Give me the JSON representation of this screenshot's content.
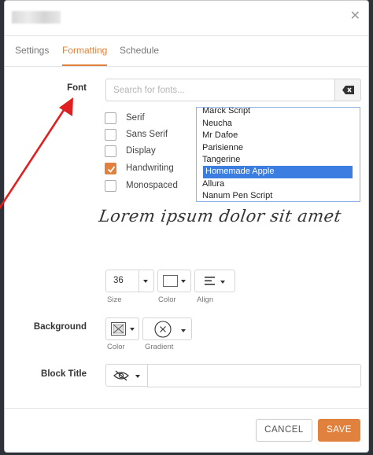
{
  "tabs": [
    {
      "label": "Settings"
    },
    {
      "label": "Formatting"
    },
    {
      "label": "Schedule"
    }
  ],
  "active_tab": "Formatting",
  "font": {
    "label": "Font",
    "search_placeholder": "Search for fonts...",
    "categories": [
      {
        "label": "Serif",
        "checked": false
      },
      {
        "label": "Sans Serif",
        "checked": false
      },
      {
        "label": "Display",
        "checked": false
      },
      {
        "label": "Handwriting",
        "checked": true
      },
      {
        "label": "Monospaced",
        "checked": false
      }
    ],
    "font_list": [
      "Marck Script",
      "Neucha",
      "Mr Dafoe",
      "Parisienne",
      "Tangerine",
      "Homemade Apple",
      "Allura",
      "Nanum Pen Script"
    ],
    "selected_font": "Homemade Apple",
    "preview_text": "Lorem ipsum dolor sit amet"
  },
  "text_controls": {
    "size_value": "36",
    "size_caption": "Size",
    "color_caption": "Color",
    "align_caption": "Align"
  },
  "background": {
    "label": "Background",
    "color_caption": "Color",
    "gradient_caption": "Gradient"
  },
  "block_title": {
    "label": "Block Title"
  },
  "footer": {
    "cancel_label": "CANCEL",
    "save_label": "SAVE"
  },
  "colors": {
    "accent": "#e0823d",
    "selection": "#3b7de0",
    "annotation_arrow": "#e02020"
  },
  "icons": {
    "close": "close-icon",
    "clear": "backspace-icon",
    "align": "align-left-icon",
    "no_color": "no-color-icon",
    "gradient": "circle-x-icon",
    "hidden": "eye-slash-icon"
  }
}
